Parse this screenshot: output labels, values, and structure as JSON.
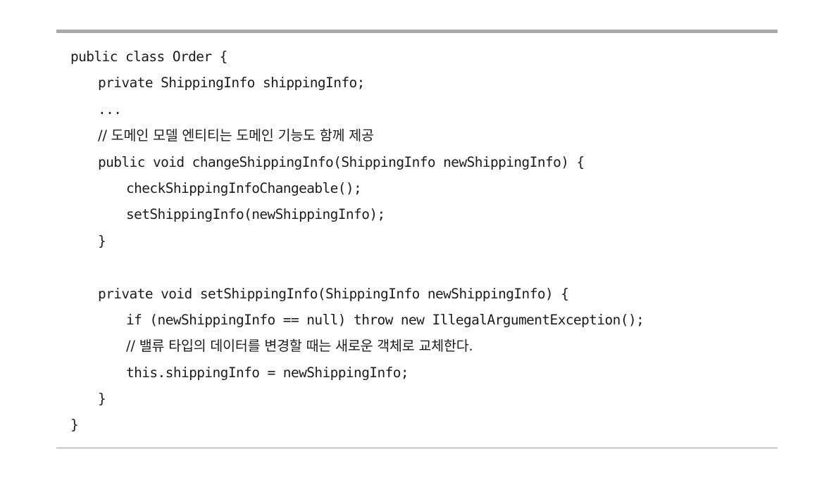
{
  "code": {
    "lines": [
      {
        "text": "public class Order {",
        "indent": 0
      },
      {
        "text": "private ShippingInfo shippingInfo;",
        "indent": 1
      },
      {
        "text": "...",
        "indent": 1
      },
      {
        "text": "// 도메인 모델 엔티티는 도메인 기능도 함께 제공",
        "indent": 1
      },
      {
        "text": "public void changeShippingInfo(ShippingInfo newShippingInfo) {",
        "indent": 1
      },
      {
        "text": "checkShippingInfoChangeable();",
        "indent": 2
      },
      {
        "text": "setShippingInfo(newShippingInfo);",
        "indent": 2
      },
      {
        "text": "}",
        "indent": 1
      },
      {
        "text": "",
        "indent": 0
      },
      {
        "text": "private void setShippingInfo(ShippingInfo newShippingInfo) {",
        "indent": 1
      },
      {
        "text": "if (newShippingInfo == null) throw new IllegalArgumentException();",
        "indent": 2
      },
      {
        "text": "// 밸류 타입의 데이터를 변경할 때는 새로운 객체로 교체한다.",
        "indent": 2
      },
      {
        "text": "this.shippingInfo = newShippingInfo;",
        "indent": 2
      },
      {
        "text": "}",
        "indent": 1
      },
      {
        "text": "}",
        "indent": 0
      }
    ]
  }
}
